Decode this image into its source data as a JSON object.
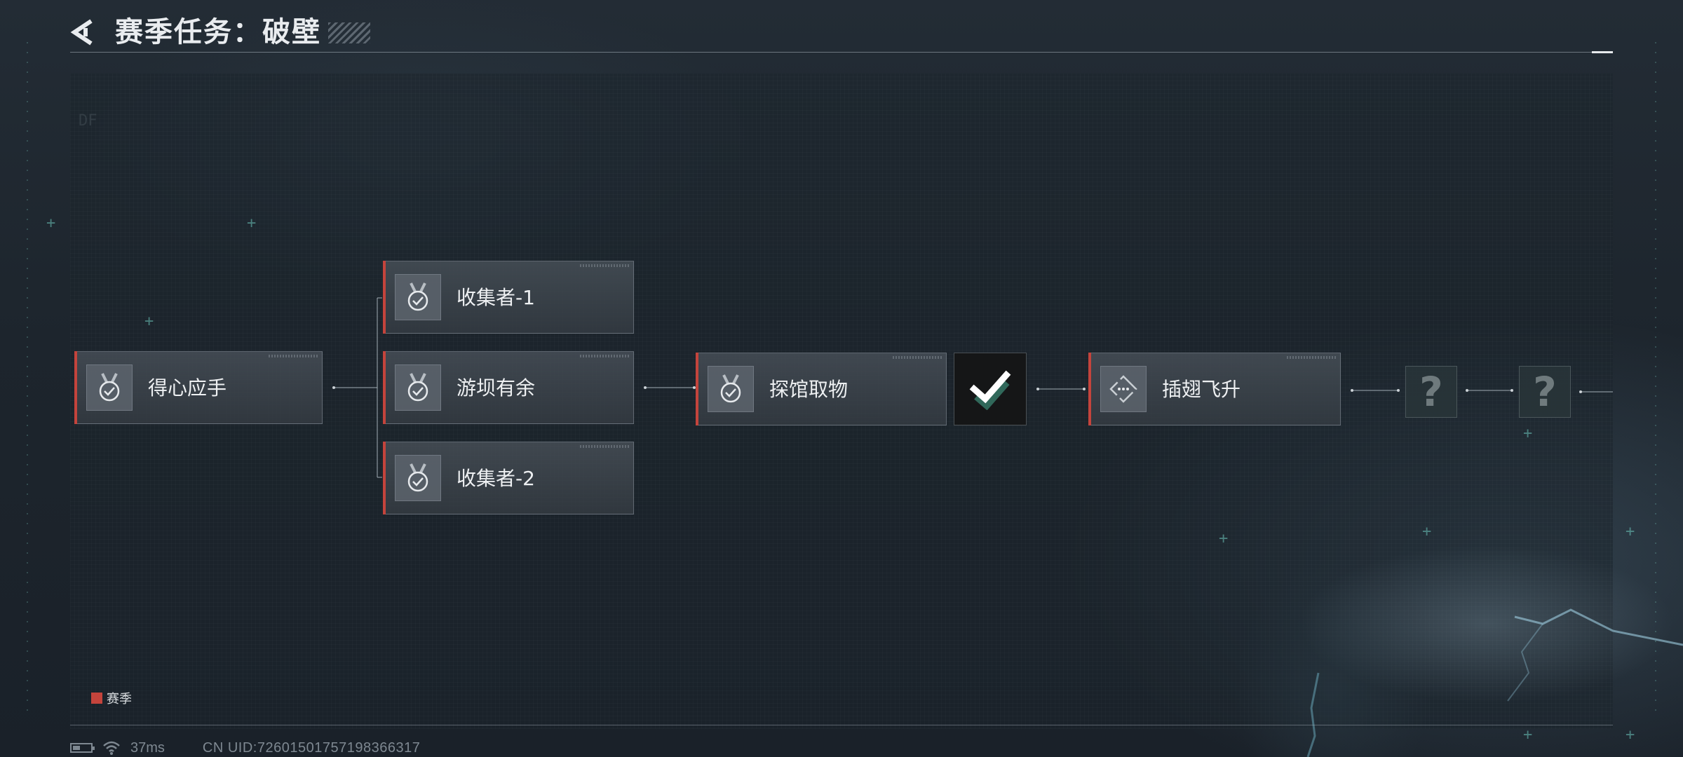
{
  "header": {
    "title": "赛季任务：破壁",
    "back_icon": "chevron-left-icon"
  },
  "colors": {
    "accent": "#c4443c",
    "background": "#1b232b",
    "node_bg": "#474f57",
    "checkmark": "#ffffff"
  },
  "tasks": {
    "node1": {
      "label": "得心应手",
      "icon": "medal-check-icon",
      "status": "completed"
    },
    "node2a": {
      "label": "收集者-1",
      "icon": "medal-check-icon",
      "status": "completed"
    },
    "node2b": {
      "label": "游坝有余",
      "icon": "medal-check-icon",
      "status": "completed"
    },
    "node2c": {
      "label": "收集者-2",
      "icon": "medal-check-icon",
      "status": "completed"
    },
    "node3": {
      "label": "探馆取物",
      "icon": "medal-check-icon",
      "status": "completed"
    },
    "node4": {
      "label": "插翅飞升",
      "icon": "diamond-dots-icon",
      "status": "in-progress"
    },
    "reward_check": {
      "icon": "checkmark-icon"
    },
    "locked1": {
      "label": "?",
      "icon": "question-mark-icon"
    },
    "locked2": {
      "label": "?",
      "icon": "question-mark-icon"
    }
  },
  "legend": {
    "label": "赛季",
    "color": "#c4443c"
  },
  "status_bar": {
    "battery_icon": "battery-icon",
    "battery_level": 0.4,
    "wifi_icon": "wifi-icon",
    "ping": "37ms",
    "uid": "CN UID:7260150175719836​6317"
  }
}
